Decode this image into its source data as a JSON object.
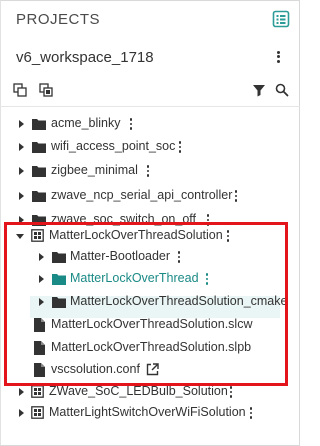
{
  "panel": {
    "title": "PROJECTS",
    "action_icon": "explorer-view-icon"
  },
  "workspace": {
    "name": "v6_workspace_1718"
  },
  "toolbar": {
    "icons": [
      "copy-icon",
      "paste-icon",
      "filter-icon",
      "search-icon"
    ]
  },
  "tree": {
    "items": [
      {
        "label": "acme_blinky",
        "kind": "folder",
        "expanded": false
      },
      {
        "label": "wifi_access_point_soc",
        "kind": "folder",
        "expanded": false
      },
      {
        "label": "zigbee_minimal",
        "kind": "folder",
        "expanded": false
      },
      {
        "label": "zwave_ncp_serial_api_controller",
        "kind": "folder",
        "expanded": false
      },
      {
        "label": "zwave_soc_switch_on_off",
        "kind": "folder",
        "expanded": false
      },
      {
        "label": "MatterLockOverThreadSolution",
        "kind": "solution",
        "expanded": true
      },
      {
        "label": "Matter-Bootloader",
        "kind": "folder",
        "expanded": false
      },
      {
        "label": "MatterLockOverThread",
        "kind": "folder",
        "expanded": false,
        "selected": true
      },
      {
        "label": "MatterLockOverThreadSolution_cmake",
        "kind": "folder",
        "expanded": false
      },
      {
        "label": "MatterLockOverThreadSolution.slcw",
        "kind": "file"
      },
      {
        "label": "MatterLockOverThreadSolution.slpb",
        "kind": "file"
      },
      {
        "label": "vscsolution.conf",
        "kind": "file",
        "external_link": true
      },
      {
        "label": "ZWave_SoC_LEDBulb_Solution",
        "kind": "solution",
        "expanded": false
      },
      {
        "label": "MatterLightSwitchOverWiFiSolution",
        "kind": "solution",
        "expanded": false
      }
    ]
  },
  "colors": {
    "selected_text": "#1a8a86",
    "selected_bg": "#eaf6f5",
    "highlight_border": "#e3141b",
    "accent_icon": "#2b9c97"
  }
}
